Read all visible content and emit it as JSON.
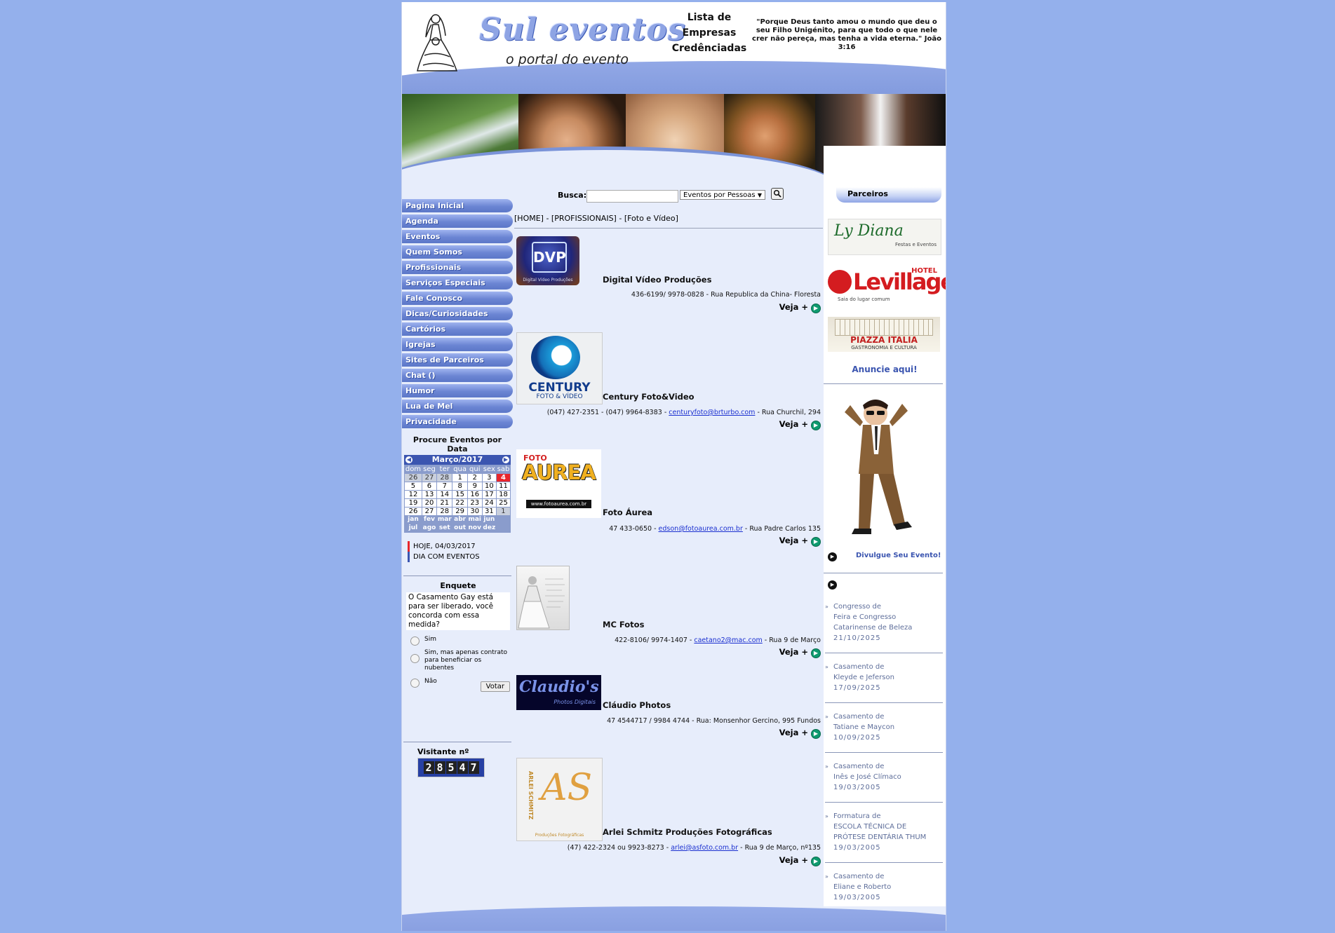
{
  "header": {
    "logo_title": "Sul eventos",
    "logo_subtitle": "o portal do evento",
    "lista": [
      "Lista de",
      "Empresas",
      "Credênciadas"
    ],
    "quote": "\"Porque Deus tanto amou o mundo que deu o seu Filho Unigénito, para que todo o que nele crer não pereça, mas tenha a vida eterna.\" João 3:16"
  },
  "nav": {
    "items": [
      "Pagina Inicial",
      "Agenda",
      "Eventos",
      "Quem Somos",
      "Profissionais",
      "Serviços Especiais",
      "Fale Conosco",
      "Dicas/Curiosidades",
      "Cartórios",
      "Igrejas",
      "Sites de Parceiros",
      "Chat  ()",
      "Humor",
      "Lua de Mel",
      "Privacidade"
    ]
  },
  "calendar": {
    "heading": "Procure Eventos por Data",
    "month": "Março/2017",
    "weekdays": [
      "dom",
      "seg",
      "ter",
      "qua",
      "qui",
      "sex",
      "sab"
    ],
    "weeks": [
      [
        "26",
        "27",
        "28",
        "1",
        "2",
        "3",
        "4"
      ],
      [
        "5",
        "6",
        "7",
        "8",
        "9",
        "10",
        "11"
      ],
      [
        "12",
        "13",
        "14",
        "15",
        "16",
        "17",
        "18"
      ],
      [
        "19",
        "20",
        "21",
        "22",
        "23",
        "24",
        "25"
      ],
      [
        "26",
        "27",
        "28",
        "29",
        "30",
        "31",
        "1"
      ]
    ],
    "months_row1": [
      "jan",
      "fev",
      "mar",
      "abr",
      "mai",
      "jun"
    ],
    "months_row2": [
      "jul",
      "ago",
      "set",
      "out",
      "nov",
      "dez"
    ],
    "today_color": "#e8262b",
    "event_color": "#3b55b0"
  },
  "legend": {
    "today": "HOJE, 04/03/2017",
    "event": "DIA COM EVENTOS"
  },
  "poll": {
    "title": "Enquete",
    "question": "O Casamento Gay está para ser liberado, você concorda com essa medida?",
    "options": [
      "Sim",
      "Sim, mas apenas contrato para beneficiar os nubentes",
      "Não"
    ],
    "button": "Votar"
  },
  "visitors": {
    "label": "Visitante nº",
    "digits": [
      "2",
      "8",
      "5",
      "4",
      "7"
    ]
  },
  "search": {
    "label": "Busca:",
    "select_value": "Eventos por Pessoas"
  },
  "breadcrumb": "[HOME] - [PROFISSIONAIS] - [Foto e Vídeo]",
  "listings": [
    {
      "name": "Digital Vídeo Produções",
      "contact_pre": "436-6199/ 9978-0828 - Rua Republica da China- Floresta",
      "email": "",
      "contact_post": "",
      "more": "Veja +",
      "logo_text": "Digital Vídeo Produções"
    },
    {
      "name": "Century Foto&Video",
      "contact_pre": "(047) 427-2351 - (047) 9964-8383 - ",
      "email": "centuryfoto@brturbo.com",
      "contact_post": " - Rua Churchil, 294",
      "more": "Veja +",
      "logo_text": "CENTURY",
      "logo_sub": "FOTO & VÍDEO"
    },
    {
      "name": "Foto Áurea",
      "contact_pre": "47 433-0650 - ",
      "email": "edson@fotoaurea.com.br",
      "contact_post": " - Rua Padre Carlos 135",
      "more": "Veja +",
      "logo_top": "FOTO",
      "logo_text": "AUREA",
      "logo_url": "www.fotoaurea.com.br"
    },
    {
      "name": "MC Fotos",
      "contact_pre": "422-8106/ 9974-1407 - ",
      "email": "caetano2@mac.com",
      "contact_post": " - Rua 9 de Março",
      "more": "Veja +"
    },
    {
      "name": "Cláudio Photos",
      "contact_pre": "47 4544717 / 9984 4744 - Rua: Monsenhor Gercino, 995 Fundos",
      "email": "",
      "contact_post": "",
      "more": "Veja +",
      "logo_text": "Claudio's",
      "logo_sub": "Photos Digitais"
    },
    {
      "name": "Arlei Schmitz Produções Fotográficas",
      "contact_pre": "(47) 422-2324 ou 9923-8273 - ",
      "email": "arlei@asfoto.com.br",
      "contact_post": " - Rua 9 de Março, nº135",
      "more": "Veja +",
      "logo_text": "AS",
      "logo_side": "ARLEI SCHMITZ",
      "logo_sub": "Produções Fotográficas"
    }
  ],
  "right": {
    "partners_label": "Parceiros",
    "partner_diana": "Ly Diana",
    "partner_diana_sub": "Festas e Eventos",
    "partner_levillage": "Levillage",
    "partner_levillage_hotel": "HOTEL",
    "partner_levillage_sub": "Saia do lugar comum",
    "partner_piazza": "PIAZZA ITALIA",
    "partner_piazza_sub": "GASTRONOMIA E CULTURA",
    "anuncie": "Anuncie aqui!",
    "divulgue": "Divulgue Seu Evento!",
    "events": [
      {
        "type": "Congresso de",
        "title": "Feira e Congresso Catarinense de Beleza",
        "date": "21/10/2025"
      },
      {
        "type": "Casamento de",
        "title": "Kleyde e Jeferson",
        "date": "17/09/2025"
      },
      {
        "type": "Casamento de",
        "title": "Tatiane e Maycon",
        "date": "10/09/2025"
      },
      {
        "type": "Casamento de",
        "title": "Inês e José Clímaco",
        "date": "19/03/2005"
      },
      {
        "type": "Formatura de",
        "title": "ESCOLA TÉCNICA DE PRÓTESE DENTÁRIA THUM",
        "date": "19/03/2005"
      },
      {
        "type": "Casamento de",
        "title": "Eliane e Roberto",
        "date": "19/03/2005"
      }
    ]
  },
  "colors": {
    "background": "#94b0ec",
    "page": "#e7edfb",
    "nav": "#6b85d3",
    "accent": "#3b55b0",
    "link": "#1a2fd0",
    "veja_icon": "#0e9a6f"
  },
  "icons": {
    "search": "magnifier-icon",
    "veja": "green-arrow-icon",
    "play": "play-icon",
    "calendar_prev": "left-arrow-icon",
    "calendar_next": "right-arrow-icon"
  }
}
